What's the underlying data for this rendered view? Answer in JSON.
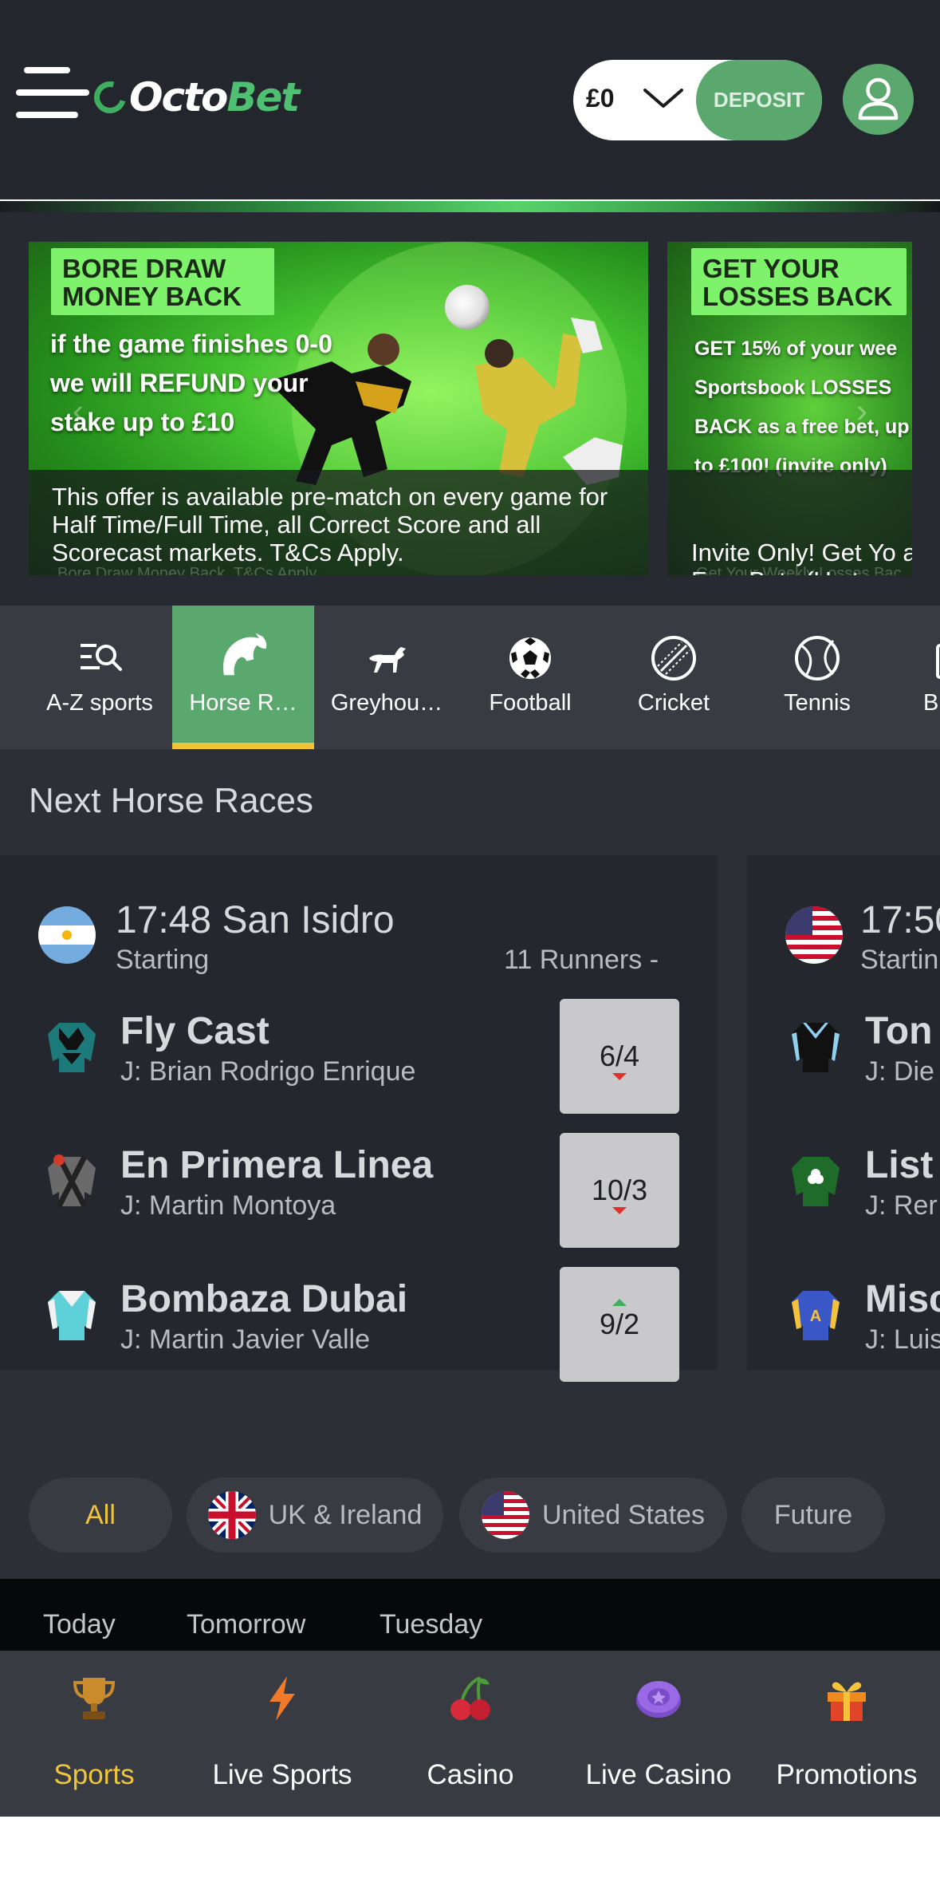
{
  "header": {
    "brand_prefix": "Octo",
    "brand_suffix": "Bet",
    "balance": "£0",
    "deposit_label": "DEPOSIT"
  },
  "promos": [
    {
      "tag_line1": "BORE DRAW",
      "tag_line2": "MONEY BACK",
      "headline": "if the game finishes 0-0 we will REFUND your stake up to £10",
      "caption": "This offer is available pre-match on every game for Half Time/Full Time, all Correct Score and all Scorecast markets. T&Cs Apply.",
      "subcaption": "Bore Draw Money Back. T&Cs Apply."
    },
    {
      "tag_line1": "GET YOUR",
      "tag_line2": "LOSSES BACK",
      "headline": "GET 15% of your wee Sportsbook LOSSES BACK as a free bet, up to £100! (invite only)",
      "caption": "Invite Only! Get Yo as Free Bets (Up to",
      "subcaption": "Get Your Weekly Losses Bac"
    }
  ],
  "sports_nav": [
    {
      "label": "A-Z sports",
      "icon": "az-search-icon"
    },
    {
      "label": "Horse R…",
      "icon": "horse-head-icon",
      "active": true
    },
    {
      "label": "Greyhou…",
      "icon": "greyhound-icon"
    },
    {
      "label": "Football",
      "icon": "football-icon"
    },
    {
      "label": "Cricket",
      "icon": "cricket-ball-icon"
    },
    {
      "label": "Tennis",
      "icon": "tennis-ball-icon"
    },
    {
      "label": "B",
      "icon": "sport-icon"
    }
  ],
  "next_races": {
    "title": "Next Horse Races",
    "races": [
      {
        "time_venue": "17:48 San Isidro",
        "status": "Starting",
        "runners": "11 Runners  -",
        "country": "Argentina",
        "horses": [
          {
            "name": "Fly Cast",
            "jockey": "J: Brian Rodrigo Enrique",
            "odds": "6/4",
            "trend": "down"
          },
          {
            "name": "En Primera Linea",
            "jockey": "J: Martin Montoya",
            "odds": "10/3",
            "trend": "down"
          },
          {
            "name": "Bombaza Dubai",
            "jockey": "J: Martin Javier Valle",
            "odds": "9/2",
            "trend": "up"
          }
        ]
      },
      {
        "time_venue": "17:50",
        "status": "Startin",
        "country": "United States",
        "horses": [
          {
            "name": "Ton",
            "jockey": "J: Die"
          },
          {
            "name": "List",
            "jockey": "J: Rer"
          },
          {
            "name": "Misc",
            "jockey": "J: Luis"
          }
        ]
      }
    ]
  },
  "filters": [
    "All",
    "UK & Ireland",
    "United States",
    "Future"
  ],
  "day_tabs": [
    "Today",
    "Tomorrow",
    "Tuesday"
  ],
  "bottom_nav": [
    {
      "label": "Sports",
      "icon": "trophy-icon",
      "active": true
    },
    {
      "label": "Live Sports",
      "icon": "lightning-icon"
    },
    {
      "label": "Casino",
      "icon": "cherries-icon"
    },
    {
      "label": "Live Casino",
      "icon": "casino-chip-icon"
    },
    {
      "label": "Promotions",
      "icon": "gift-icon"
    }
  ],
  "colors": {
    "brand_green": "#5aa86d",
    "accent_yellow": "#f0c53a",
    "background": "#2c2f36",
    "odds_down": "#e0302a",
    "odds_up": "#3fae5e"
  }
}
